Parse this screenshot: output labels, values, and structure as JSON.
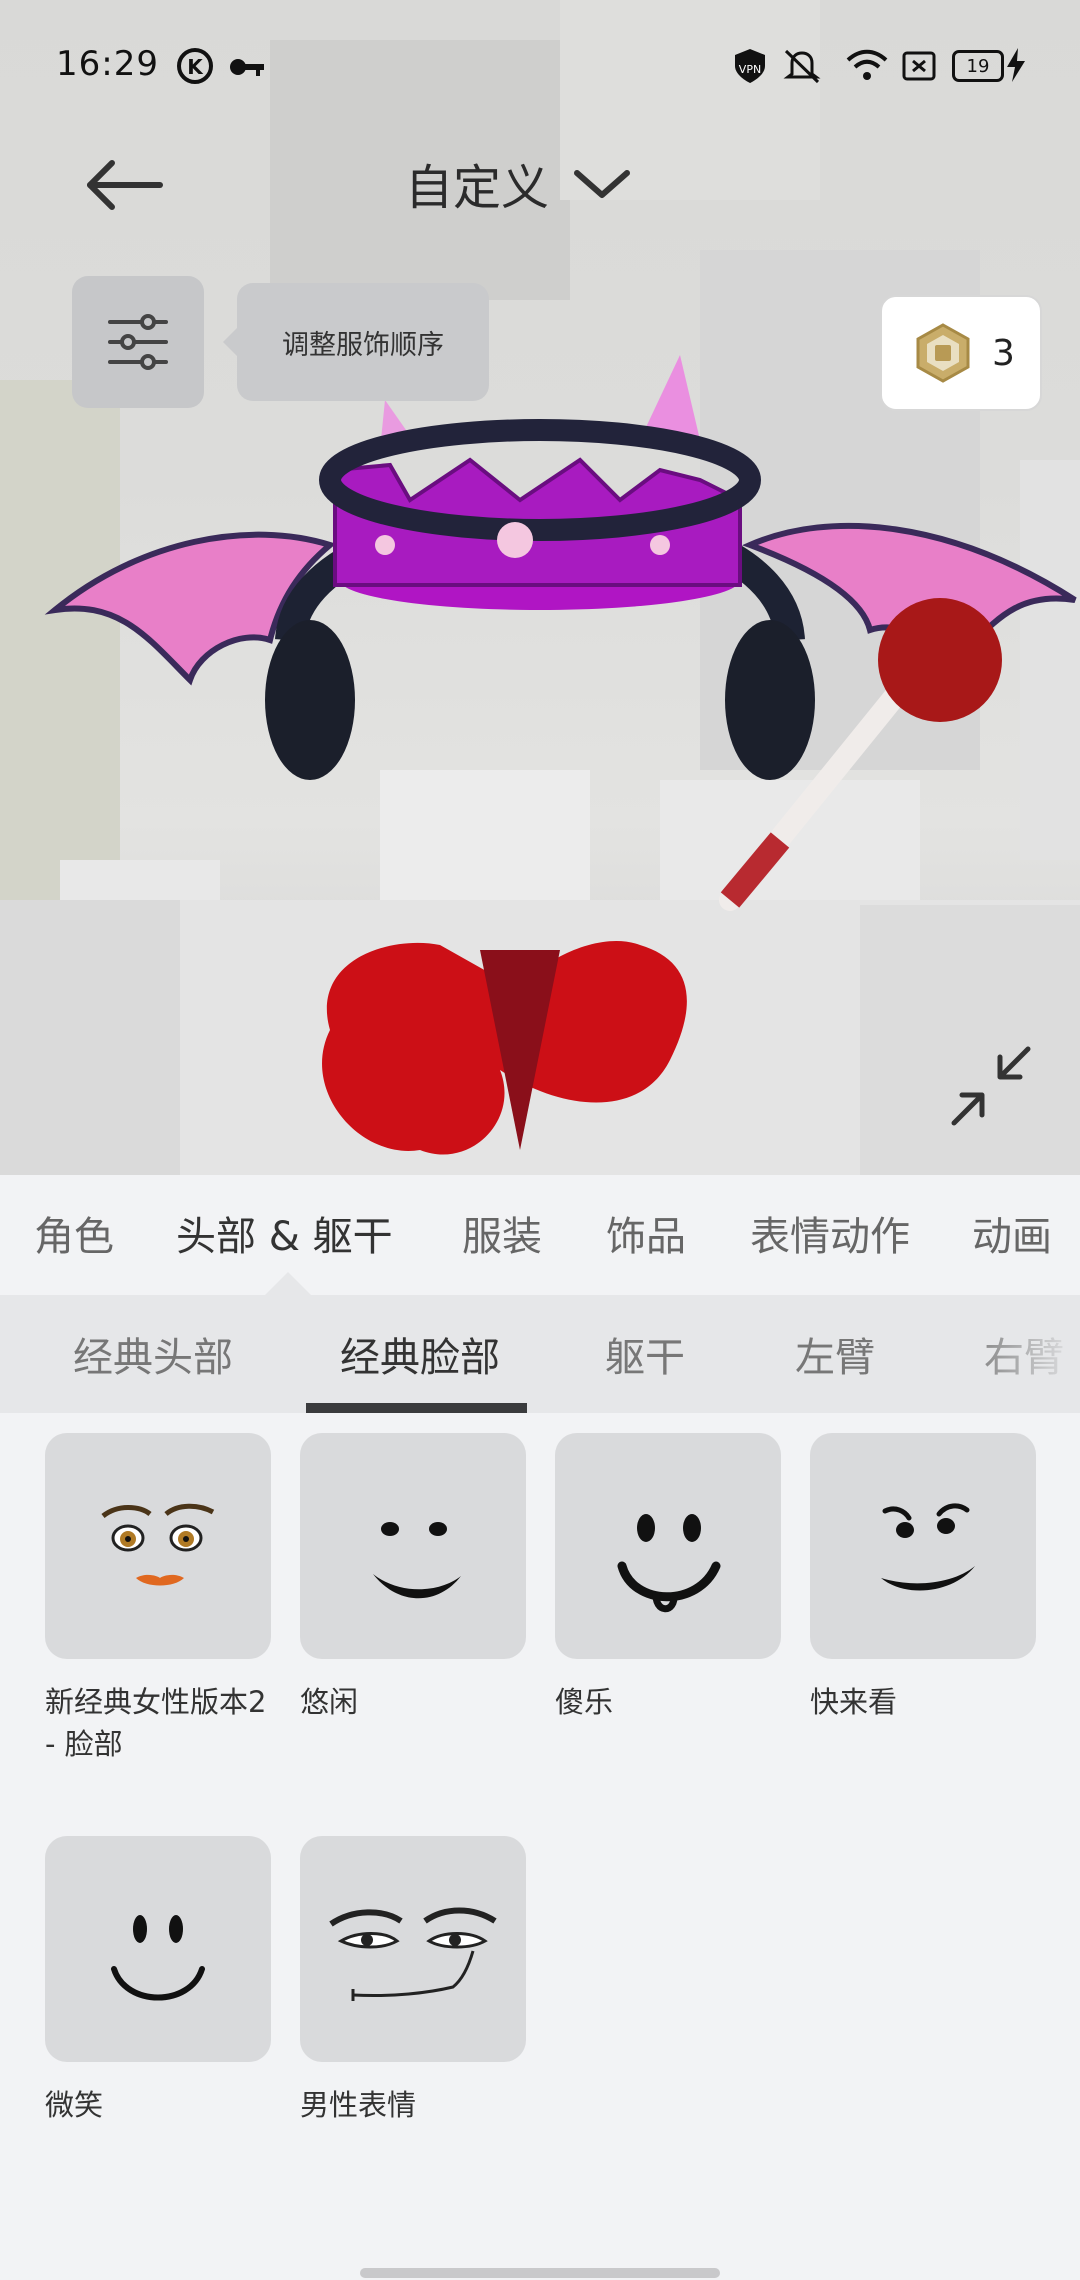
{
  "status_bar": {
    "time": "16:29",
    "battery": "19",
    "icons": [
      "k-app-icon",
      "key-icon",
      "vpn-icon",
      "mute-icon",
      "wifi-icon",
      "sim-icon",
      "battery-icon",
      "charging-icon"
    ]
  },
  "header": {
    "title": "自定义",
    "tooltip": "调整服饰顺序",
    "robux_count": "3"
  },
  "category_tabs": [
    "角色",
    "头部 & 躯干",
    "服装",
    "饰品",
    "表情动作",
    "动画"
  ],
  "active_category": "头部 & 躯干",
  "sub_tabs": [
    "经典头部",
    "经典脸部",
    "躯干",
    "左臂",
    "右臂"
  ],
  "active_sub_tab": "经典脸部",
  "items": [
    {
      "name": "新经典女性版本2 - 脸部",
      "face": "woman-face"
    },
    {
      "name": "悠闲",
      "face": "chill-face"
    },
    {
      "name": "傻乐",
      "face": "silly-face"
    },
    {
      "name": "快来看",
      "face": "check-it-face"
    },
    {
      "name": "微笑",
      "face": "smile-face"
    },
    {
      "name": "男性表情",
      "face": "man-face"
    }
  ],
  "colors": {
    "accent": "#3a3b3d",
    "background": "#f2f3f5",
    "tab_bar": "#e6e7e9",
    "thumb": "#d9dadc"
  }
}
